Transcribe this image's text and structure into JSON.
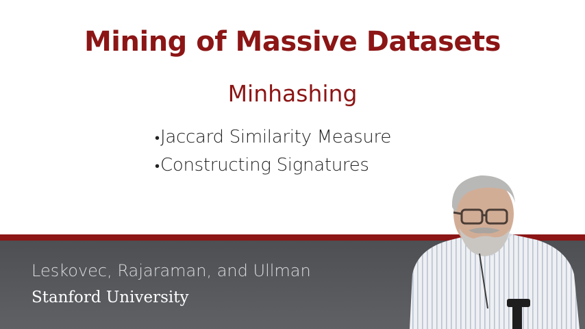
{
  "slide": {
    "title": "Mining of Massive Datasets",
    "subtitle": "Minhashing",
    "bullets": [
      "Jaccard Similarity Measure",
      "Constructing Signatures"
    ],
    "bullet_glyph": "•"
  },
  "footer": {
    "authors": "Leskovec, Rajaraman, and Ullman",
    "university": "Stanford University"
  },
  "colors": {
    "accent": "#8c1515",
    "footer_bg": "#4d4f53",
    "slide_bg": "#ffffff"
  }
}
